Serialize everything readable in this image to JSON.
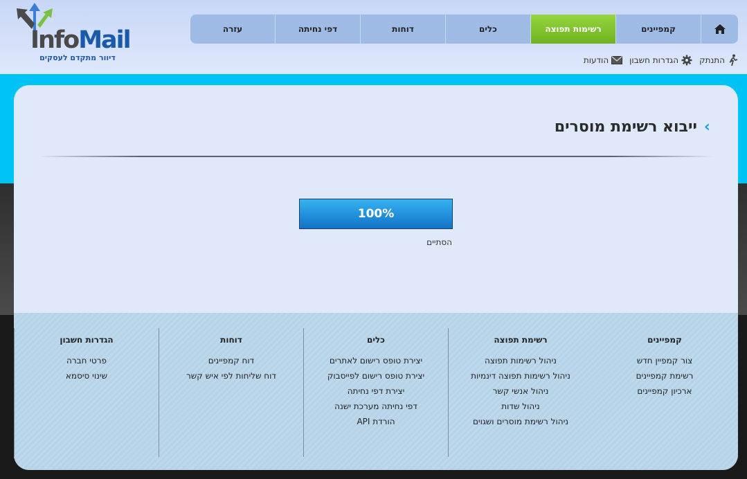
{
  "brand": {
    "logo_part1": "Info",
    "logo_part2": "Mail",
    "tagline": "דיוור מתקדם לעסקים",
    "colors": {
      "brand_blue": "#1b5aab",
      "arrow_green": "#7ac143",
      "arrow_blue": "#3b7fd4",
      "arrow_dark": "#4a4a4a"
    }
  },
  "nav": {
    "home_icon": "home-icon",
    "tabs": [
      {
        "label": "קמפיינים",
        "active": false
      },
      {
        "label": "רשימות תפוצה",
        "active": true
      },
      {
        "label": "כלים",
        "active": false
      },
      {
        "label": "דוחות",
        "active": false
      },
      {
        "label": "דפי נחיתה",
        "active": false
      },
      {
        "label": "עזרה",
        "active": false
      }
    ],
    "active_color": "#7ac143"
  },
  "util": {
    "messages": {
      "label": "הודעות",
      "icon": "envelope-icon"
    },
    "settings": {
      "label": "הגדרות חשבון",
      "icon": "gear-icon"
    },
    "logout": {
      "label": "התנתק",
      "icon": "running-person-icon"
    }
  },
  "page": {
    "title": "ייבוא רשימת מוסרים",
    "title_icon": "chevron-right-icon"
  },
  "progress": {
    "percent": 100,
    "label": "100%",
    "status": "הסתיים"
  },
  "footer": {
    "columns": [
      {
        "heading": "קמפיינים",
        "links": [
          "צור קמפיין חדש",
          "רשימת קמפיינים",
          "ארכיון קמפיינים"
        ]
      },
      {
        "heading": "רשימת תפוצה",
        "links": [
          "ניהול רשימות תפוצה",
          "ניהול רשימות תפוצה דינמיות",
          "ניהול אנשי קשר",
          "ניהול שדות",
          "ניהול רשימת מוסרים ושגוים"
        ]
      },
      {
        "heading": "כלים",
        "links": [
          "יצירת טופס רישום לאתרים",
          "יצירת טופס רישום לפייסבוק",
          "יצירת דפי נחיתה",
          "דפי נחיתה מערכת ישנה",
          "הורדת API"
        ]
      },
      {
        "heading": "דוחות",
        "links": [
          "דוח קמפיינים",
          "דוח שליחות לפי איש קשר"
        ]
      },
      {
        "heading": "הגדרות חשבון",
        "links": [
          "פרטי חברה",
          "שינוי סיסמא"
        ]
      }
    ]
  },
  "colors": {
    "cyan_band": "#00c3f5",
    "card_bg": "#dfe9fa",
    "progress_blue": "#1a8ee0"
  }
}
